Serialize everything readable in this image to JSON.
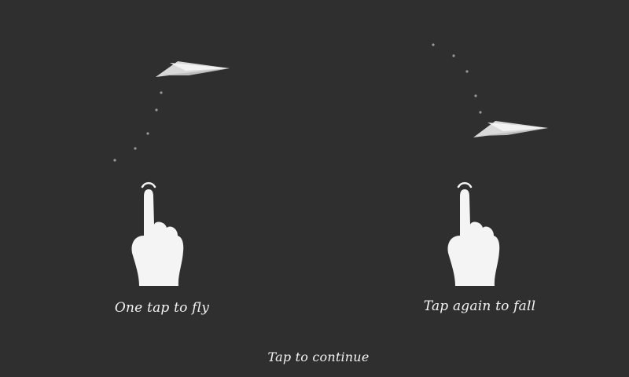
{
  "tutorial": {
    "left_caption": "One tap to fly",
    "right_caption": "Tap again to fall",
    "continue_label": "Tap to continue"
  },
  "icons": {
    "plane": "paper-plane-icon",
    "hand": "tapping-hand-icon",
    "trail": "dotted-trail-icon"
  },
  "colors": {
    "background": "#2f2f2f",
    "foreground": "#f4f4f4",
    "trail": "#9a9a9a"
  }
}
